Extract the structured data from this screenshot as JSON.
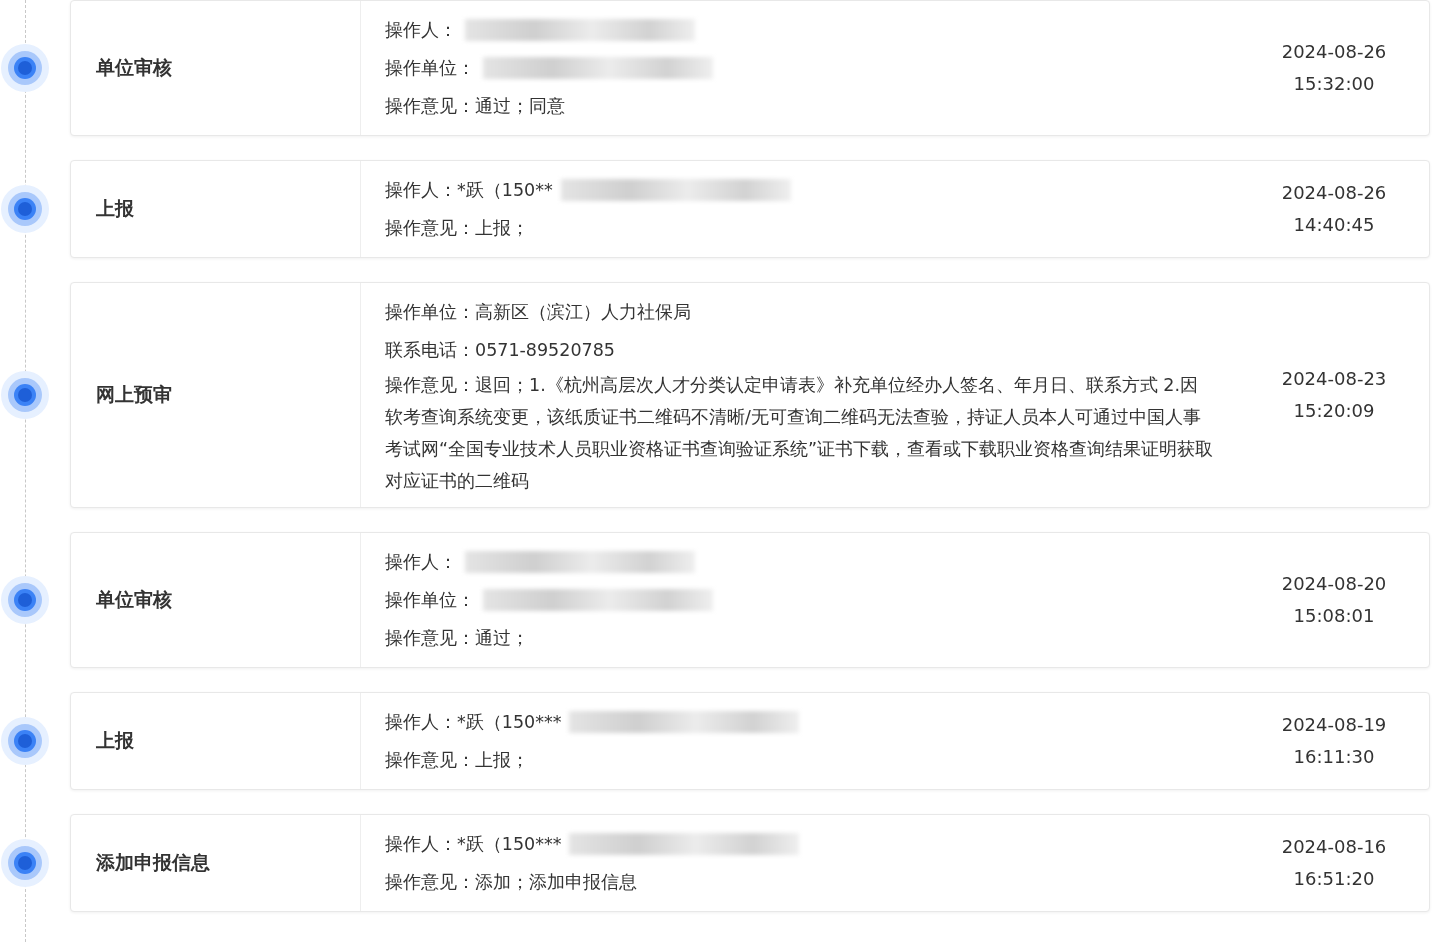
{
  "records": [
    {
      "title": "单位审核",
      "fields": [
        {
          "label": "操作人：",
          "redacted": true
        },
        {
          "label": "操作单位：",
          "redacted": true
        },
        {
          "label": "操作意见：",
          "value": "通过；同意",
          "redacted": false
        }
      ],
      "date": "2024-08-26",
      "time": "15:32:00"
    },
    {
      "title": "上报",
      "fields": [
        {
          "label": "操作人：",
          "value": "*跃（150**",
          "redacted": true
        },
        {
          "label": "操作意见：",
          "value": "上报；",
          "redacted": false
        }
      ],
      "date": "2024-08-26",
      "time": "14:40:45"
    },
    {
      "title": "网上预审",
      "fields": [
        {
          "label": "操作单位：",
          "value": "高新区（滨江）人力社保局",
          "redacted": false
        },
        {
          "label": "联系电话：",
          "value": "0571-89520785",
          "redacted": false
        },
        {
          "label": "操作意见：",
          "value": "退回；1.《杭州高层次人才分类认定申请表》补充单位经办人签名、年月日、联系方式 2.因软考查询系统变更，该纸质证书二维码不清晰/无可查询二维码无法查验，持证人员本人可通过中国人事考试网“全国专业技术人员职业资格证书查询验证系统”证书下载，查看或下载职业资格查询结果证明获取对应证书的二维码",
          "redacted": false
        }
      ],
      "date": "2024-08-23",
      "time": "15:20:09"
    },
    {
      "title": "单位审核",
      "fields": [
        {
          "label": "操作人：",
          "redacted": true
        },
        {
          "label": "操作单位：",
          "redacted": true
        },
        {
          "label": "操作意见：",
          "value": "通过；",
          "redacted": false
        }
      ],
      "date": "2024-08-20",
      "time": "15:08:01"
    },
    {
      "title": "上报",
      "fields": [
        {
          "label": "操作人：",
          "value": "*跃（150***",
          "redacted": true
        },
        {
          "label": "操作意见：",
          "value": "上报；",
          "redacted": false
        }
      ],
      "date": "2024-08-19",
      "time": "16:11:30"
    },
    {
      "title": "添加申报信息",
      "fields": [
        {
          "label": "操作人：",
          "value": "*跃（150***",
          "redacted": true
        },
        {
          "label": "操作意见：",
          "value": "添加；添加申报信息",
          "redacted": false
        }
      ],
      "date": "2024-08-16",
      "time": "16:51:20"
    }
  ]
}
